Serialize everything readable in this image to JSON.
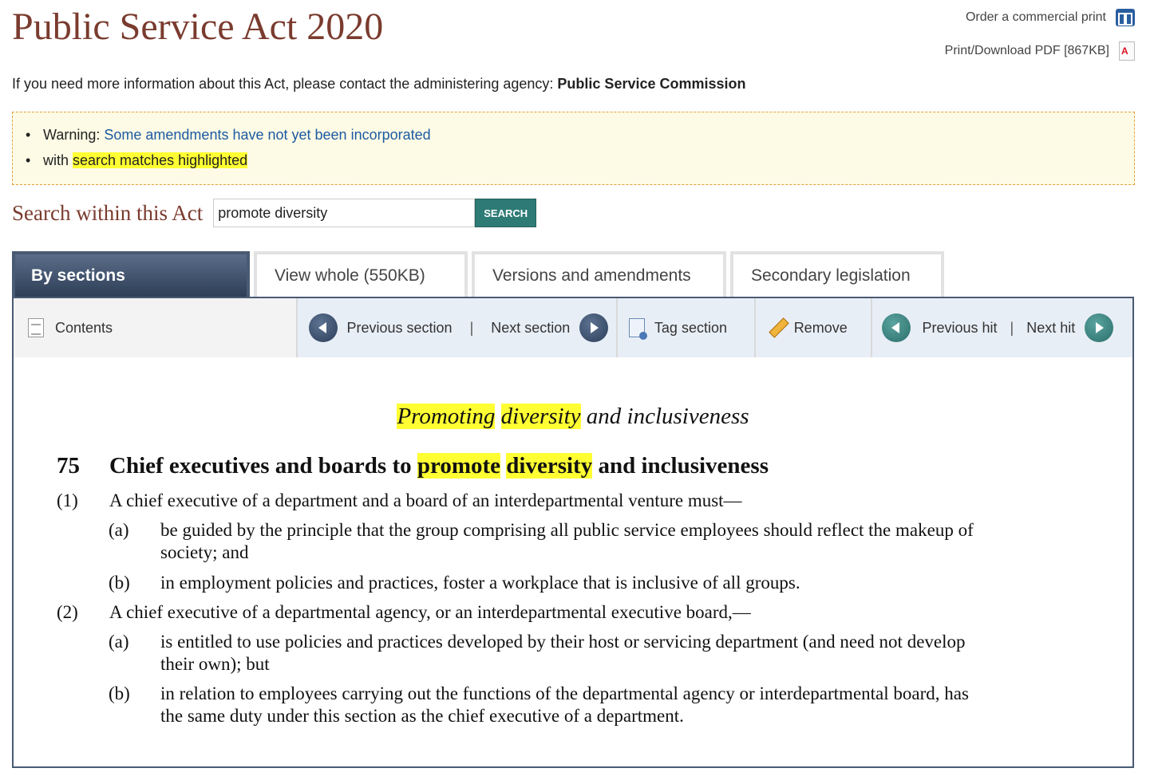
{
  "page": {
    "title": "Public Service Act 2020",
    "links": {
      "order_print": "Order a commercial print",
      "download_pdf": "Print/Download PDF [867KB]"
    },
    "agency_prefix": "If you need more information about this Act, please contact the administering agency:",
    "agency_name": "Public Service Commission"
  },
  "notice": {
    "warning_prefix": "Warning:",
    "warning_link": "Some amendments have not yet been incorporated",
    "search_prefix": "with",
    "search_highlight": "search matches highlighted"
  },
  "search": {
    "label": "Search within this Act",
    "value": "promote diversity",
    "button": "SEARCH"
  },
  "tabs": [
    {
      "label": "By sections",
      "active": true
    },
    {
      "label": "View whole (550KB)",
      "active": false
    },
    {
      "label": "Versions and amendments",
      "active": false
    },
    {
      "label": "Secondary legislation",
      "active": false
    }
  ],
  "toolbar": {
    "contents": "Contents",
    "previous_section": "Previous section",
    "separator": "|",
    "next_section": "Next section",
    "tag_section": "Tag section",
    "remove": "Remove",
    "previous_hit": "Previous hit",
    "next_hit": "Next hit"
  },
  "document": {
    "group_heading": {
      "hl1": "Promoting",
      "hl2": "diversity",
      "rest": "and inclusiveness"
    },
    "section": {
      "number": "75",
      "title_pre": "Chief executives and boards to",
      "hl1": "promote",
      "hl2": "diversity",
      "title_post": "and inclusiveness"
    },
    "subsections": [
      {
        "num": "(1)",
        "text": "A chief executive of a department and a board of an interdepartmental venture must—",
        "paras": [
          {
            "num": "(a)",
            "line1": "be guided by the principle that the group comprising all public service employees should reflect the makeup of",
            "line2": "society; and"
          },
          {
            "num": "(b)",
            "line1": "in employment policies and practices, foster a workplace that is inclusive of all groups.",
            "line2": ""
          }
        ]
      },
      {
        "num": "(2)",
        "text": "A chief executive of a departmental agency, or an interdepartmental executive board,—",
        "paras": [
          {
            "num": "(a)",
            "line1": "is entitled to use policies and practices developed by their host or servicing department (and need not develop",
            "line2": "their own); but"
          },
          {
            "num": "(b)",
            "line1": "in relation to employees carrying out the functions of the departmental agency or interdepartmental board, has",
            "line2": "the same duty under this section as the chief executive of a department."
          }
        ]
      }
    ]
  },
  "colors": {
    "title_brown": "#7a3b2e",
    "link_blue": "#1d5aa3",
    "highlight_yellow": "#ffff33",
    "search_button_teal": "#2e7b76",
    "active_tab_navy": "#2d3d56"
  }
}
